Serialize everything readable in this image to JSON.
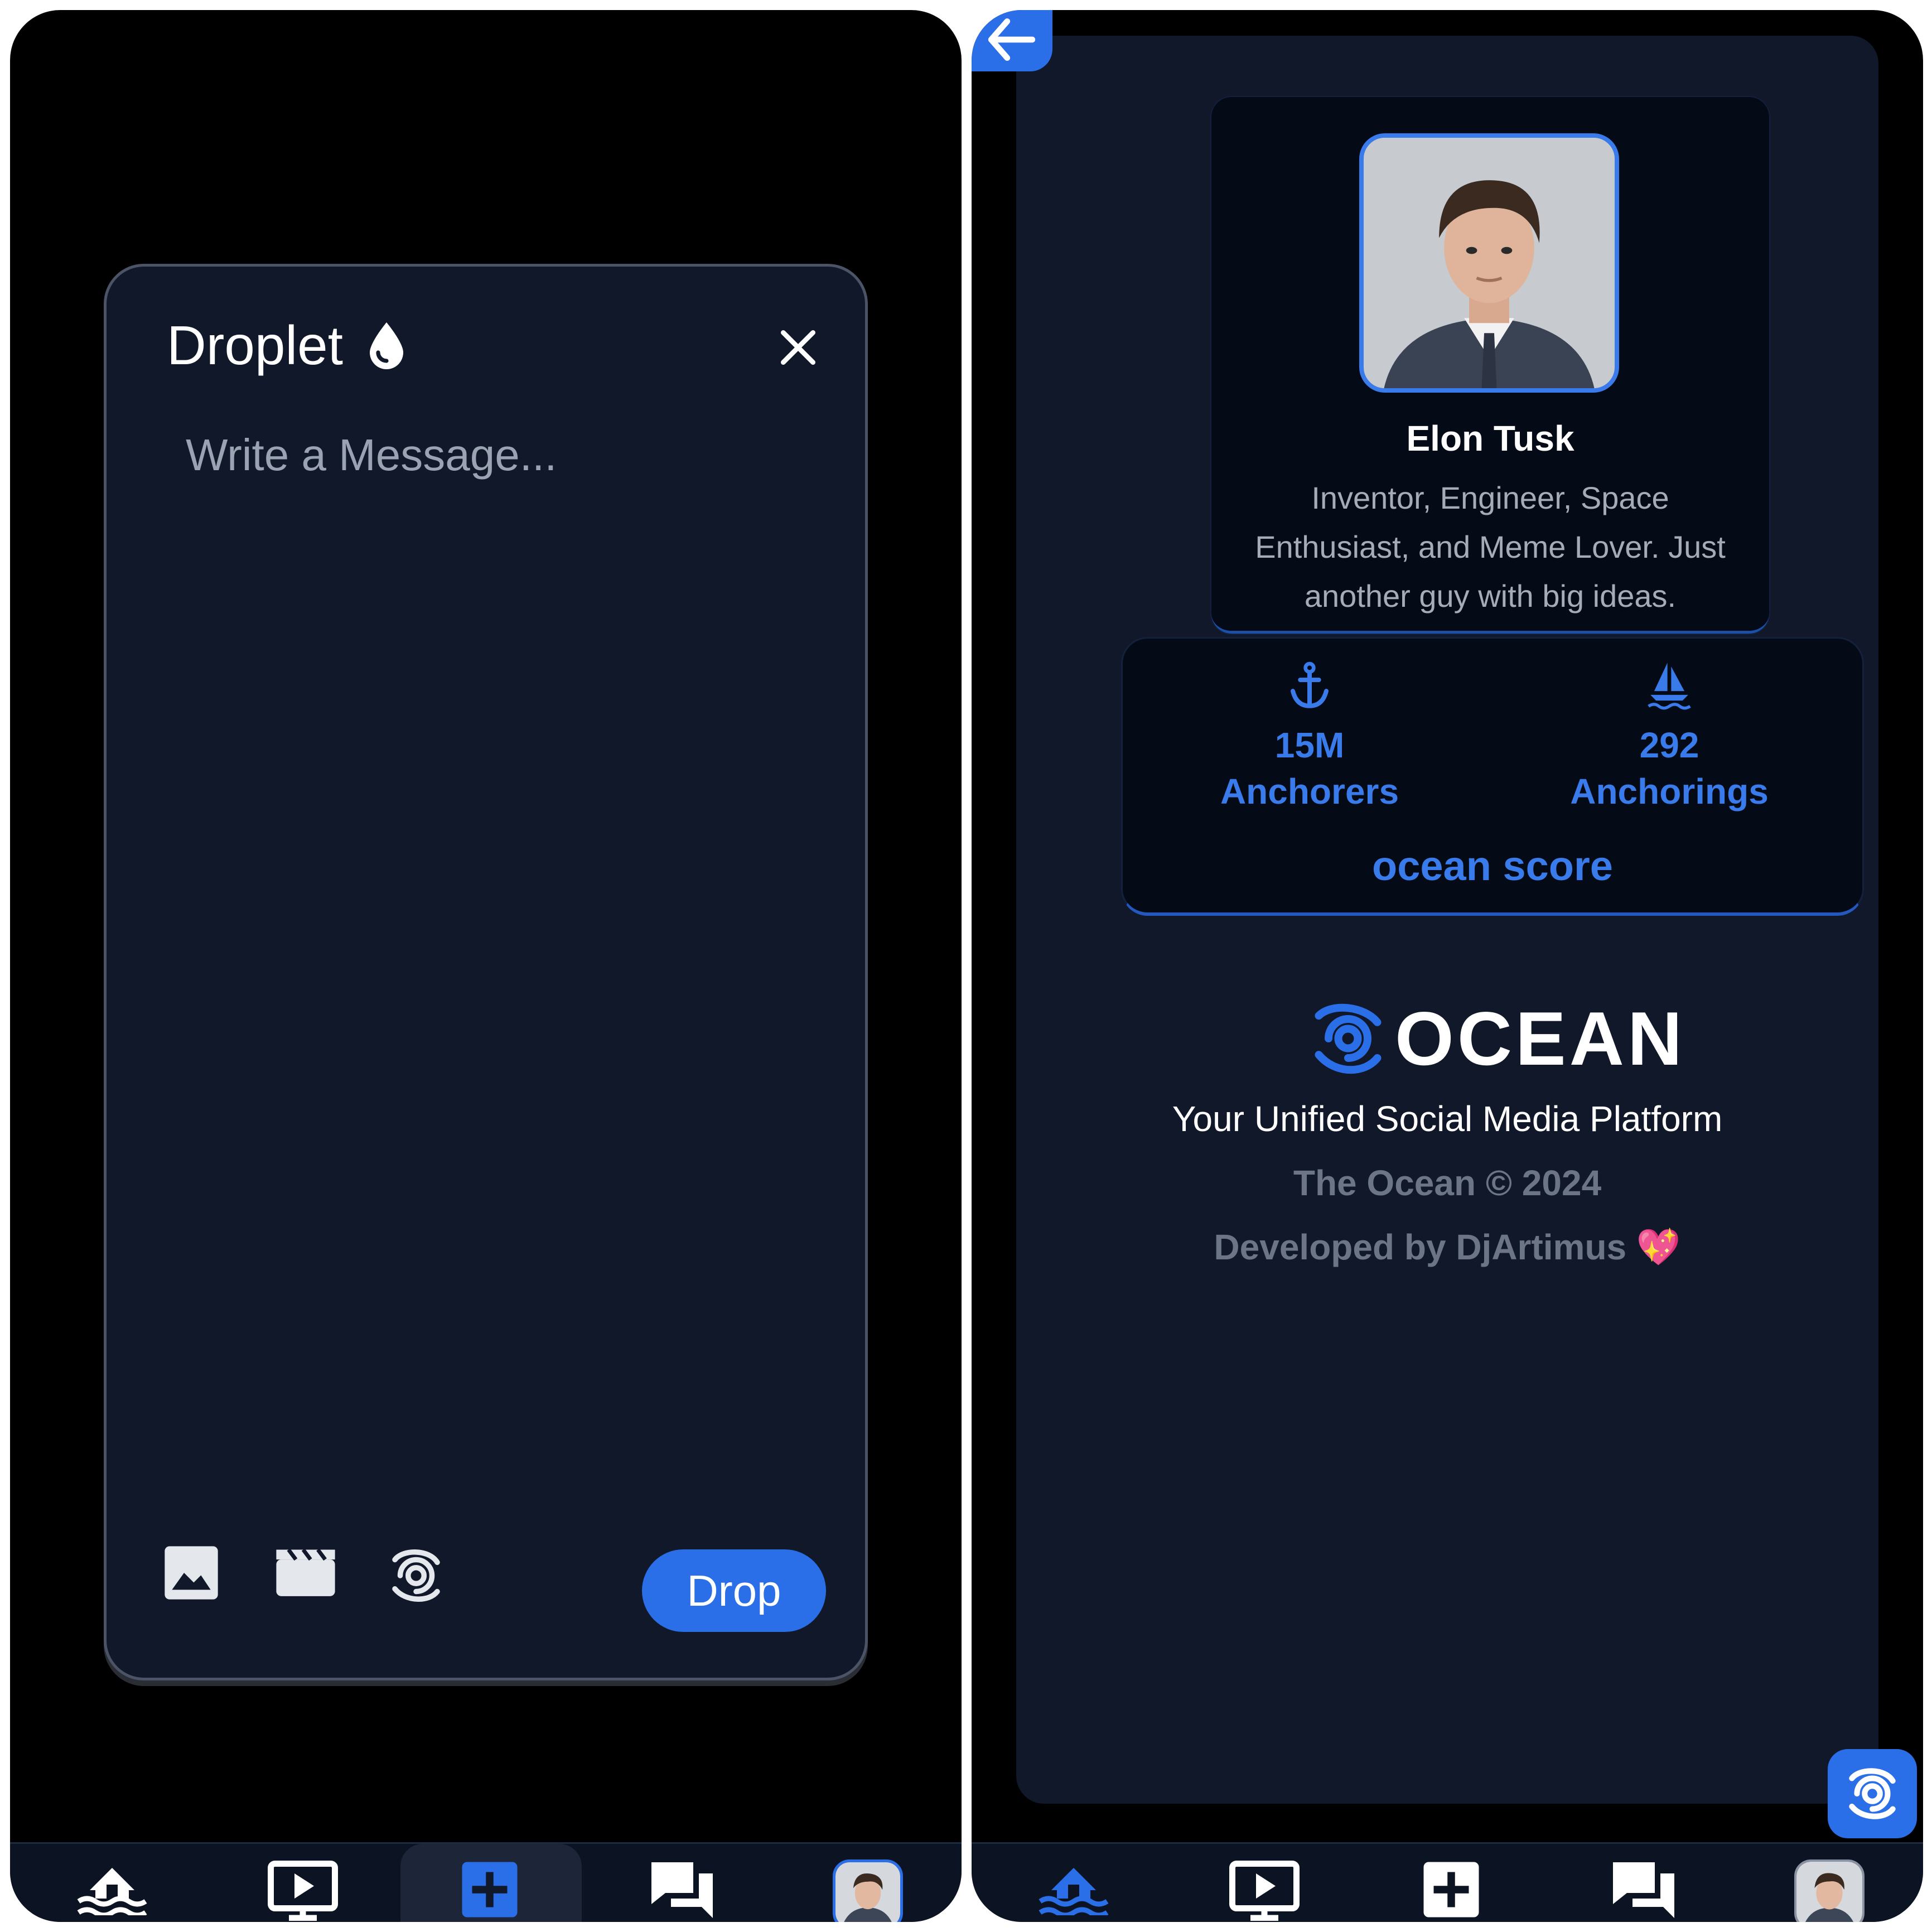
{
  "composer": {
    "title": "Droplet",
    "placeholder": "Write a Message...",
    "submit_label": "Drop",
    "tools": [
      "image-icon",
      "video-icon",
      "ocean-icon"
    ]
  },
  "nav": {
    "items": [
      "home-icon",
      "video-feed-icon",
      "create-icon",
      "messages-icon",
      "profile-avatar"
    ]
  },
  "profile": {
    "name": "Elon Tusk",
    "bio": "Inventor, Engineer, Space Enthusiast, and Meme Lover. Just another guy with big ideas.",
    "stats": [
      {
        "icon": "anchor-icon",
        "value": "15M",
        "label": "Anchorers"
      },
      {
        "icon": "sailboat-icon",
        "value": "292",
        "label": "Anchorings"
      }
    ],
    "ocean_score_label": "ocean score"
  },
  "footer": {
    "brand": "OCEAN",
    "tagline": "Your Unified Social Media Platform",
    "copyright": "The Ocean © 2024",
    "developer": "Developed by DjArtimus 💖"
  },
  "colors": {
    "accent": "#2a6ee8",
    "accent_text": "#3a7bec",
    "panel": "#101829",
    "card": "#050a17",
    "background": "#000000"
  }
}
